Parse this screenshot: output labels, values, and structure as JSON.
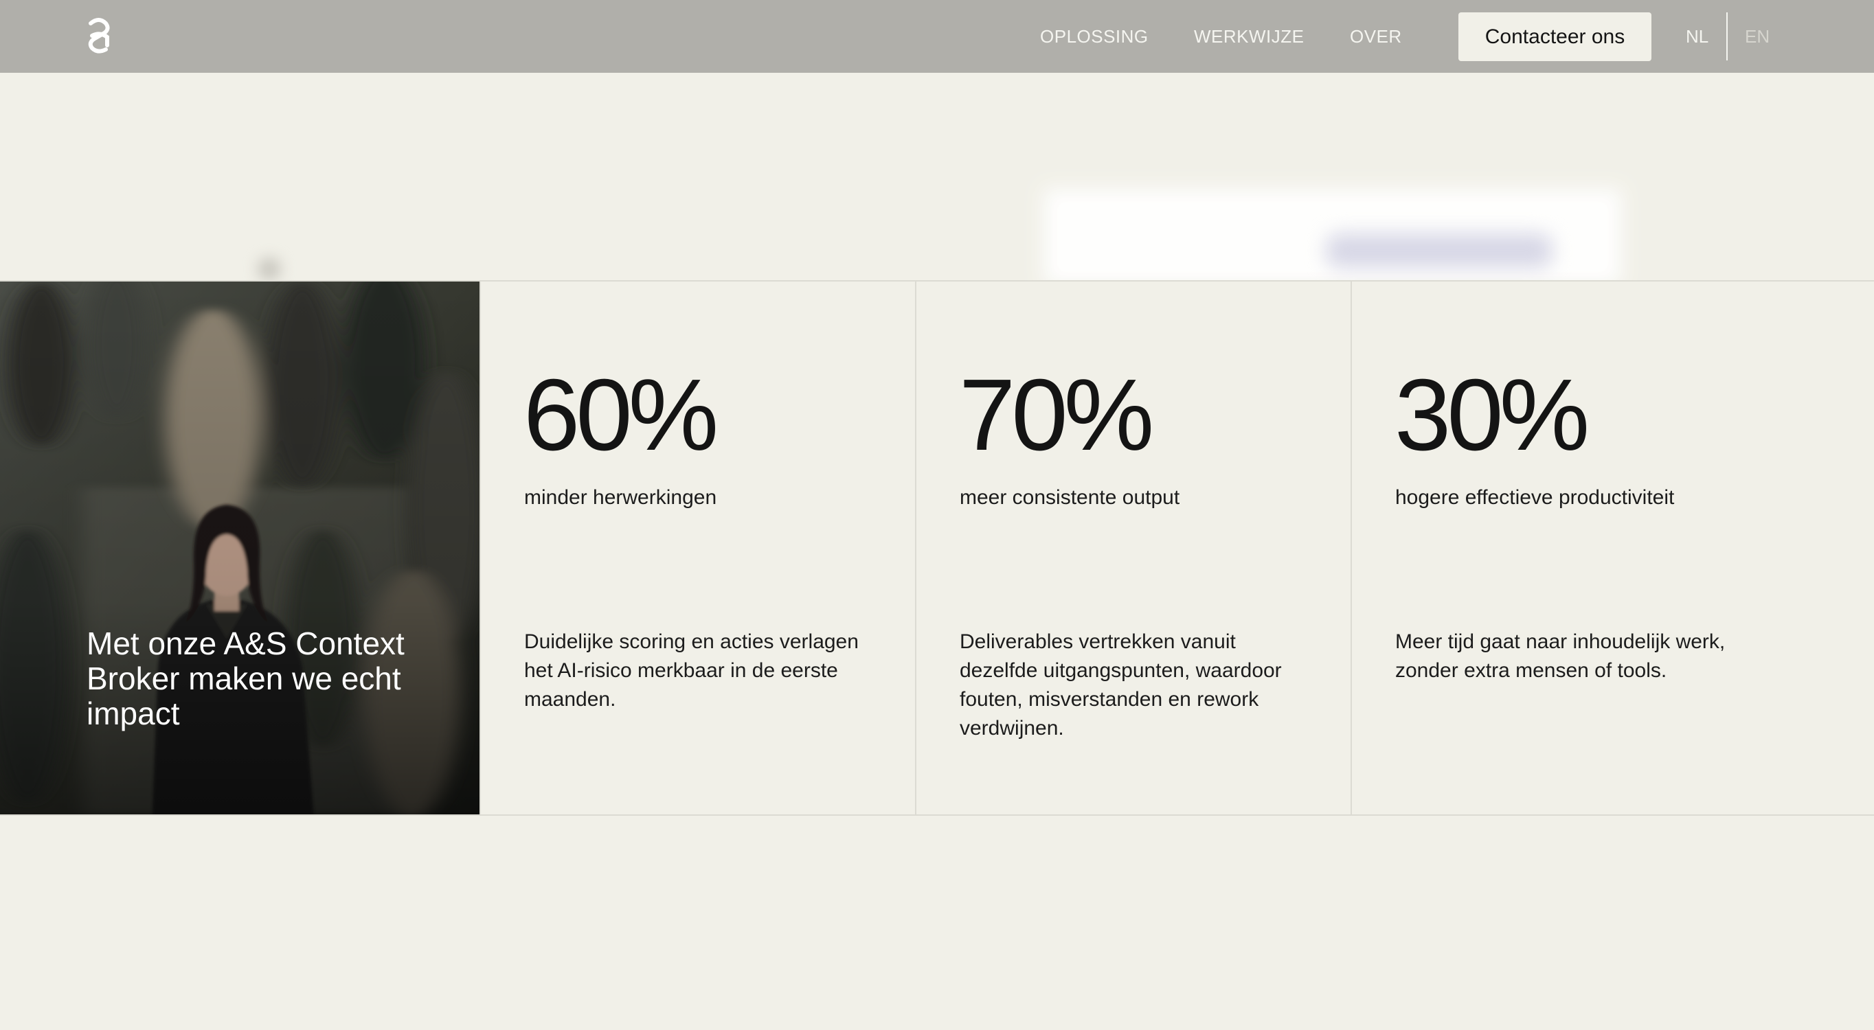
{
  "header": {
    "nav": [
      "OPLOSSING",
      "WERKWIJZE",
      "OVER"
    ],
    "cta_label": "Contacteer ons",
    "languages": {
      "active": "NL",
      "inactive": "EN"
    }
  },
  "hero_panel": {
    "caption": "Met onze A&S Context Broker maken we echt impact"
  },
  "stats": [
    {
      "value": "60%",
      "label": "minder herwerkingen",
      "description": "Duidelijke scoring en acties verlagen het AI-risico merkbaar in de eerste maanden."
    },
    {
      "value": "70%",
      "label": "meer consistente output",
      "description": "Deliverables vertrekken vanuit dezelfde uitgangspunten, waardoor fouten, misverstanden en rework verdwijnen."
    },
    {
      "value": "30%",
      "label": "hogere effectieve productiviteit",
      "description": "Meer tijd gaat naar inhoudelijk werk, zonder extra mensen of tools."
    }
  ],
  "colors": {
    "page_background": "#f1f0e8",
    "header_background": "#b0afaa",
    "text": "#141414",
    "divider": "#dcdbd3"
  }
}
